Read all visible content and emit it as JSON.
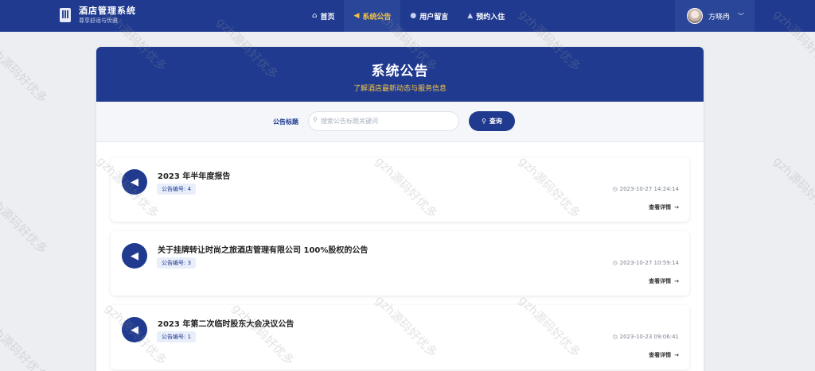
{
  "brand": {
    "title": "酒店管理系统",
    "subtitle": "尊享舒适与优雅"
  },
  "nav": [
    {
      "label": "首页",
      "icon": "home-icon",
      "glyph": "⌂",
      "active": false
    },
    {
      "label": "系统公告",
      "icon": "megaphone-icon",
      "glyph": "◀",
      "active": true
    },
    {
      "label": "用户留言",
      "icon": "chat-icon",
      "glyph": "●",
      "active": false
    },
    {
      "label": "预约入住",
      "icon": "hotel-icon",
      "glyph": "▲",
      "active": false
    }
  ],
  "user": {
    "name": "方晓冉"
  },
  "hero": {
    "title": "系统公告",
    "subtitle": "了解酒店最新动态与服务信息"
  },
  "search": {
    "label": "公告标题",
    "placeholder": "搜索公告标题关键词",
    "value": "",
    "button_label": "查询"
  },
  "notices": [
    {
      "title": "2023 年半年度报告",
      "badge": "公告编号: 4",
      "date": "2023-10-27 14:24:14",
      "more": "查看详情"
    },
    {
      "title": "关于挂牌转让时尚之旅酒店管理有限公司 100%股权的公告",
      "badge": "公告编号: 3",
      "date": "2023-10-27 10:59:14",
      "more": "查看详情"
    },
    {
      "title": "2023 年第二次临时股东大会决议公告",
      "badge": "公告编号: 1",
      "date": "2023-10-23 09:06:41",
      "more": "查看详情"
    }
  ],
  "watermark": "gzh源码好优多",
  "colors": {
    "primary": "#1f3a8f",
    "accent": "#f5c542"
  }
}
